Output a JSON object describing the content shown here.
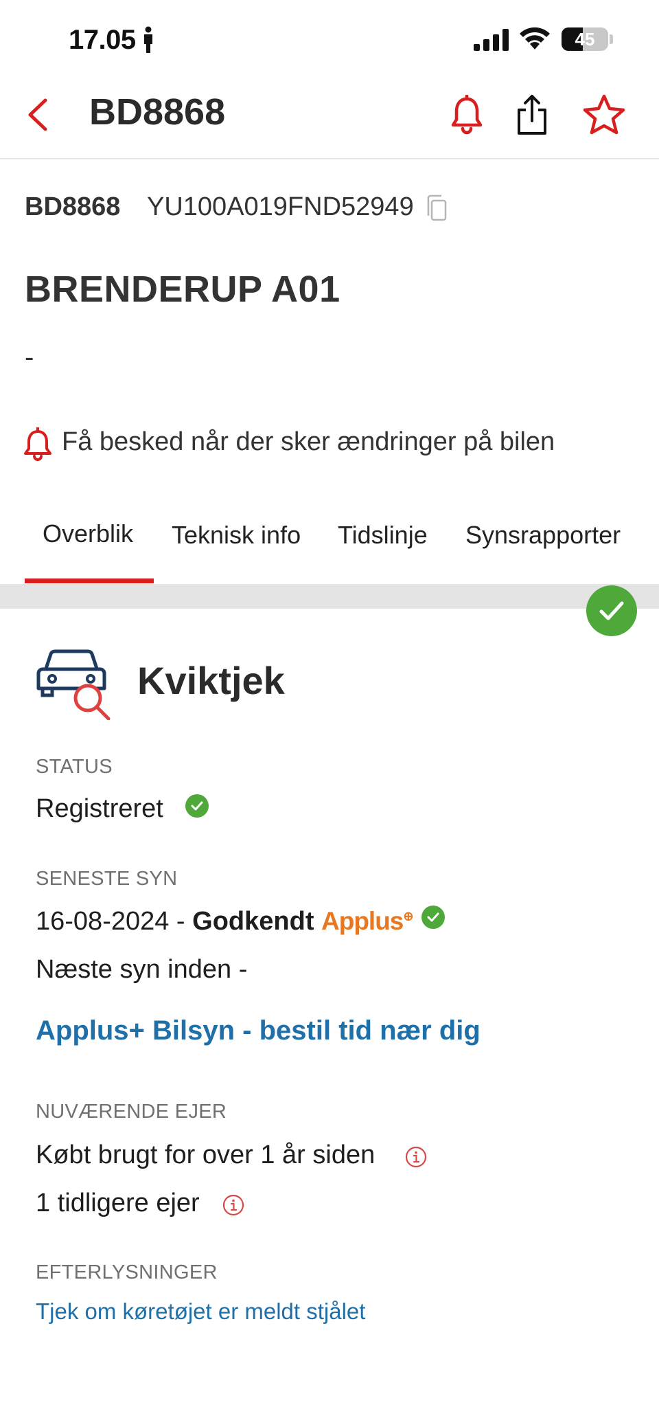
{
  "status_bar": {
    "time": "17.05",
    "battery": "45"
  },
  "nav": {
    "title": "BD8868"
  },
  "vehicle": {
    "plate": "BD8868",
    "vin": "YU100A019FND52949",
    "model": "BRENDERUP A01",
    "variant": "-"
  },
  "notify": {
    "label": "Få besked når der sker ændringer på bilen"
  },
  "tabs": [
    "Overblik",
    "Teknisk info",
    "Tidslinje",
    "Synsrapporter"
  ],
  "card": {
    "title": "Kviktjek",
    "status_label": "STATUS",
    "status_value": "Registreret",
    "inspection_label": "SENESTE SYN",
    "inspection_date": "16-08-2024 - ",
    "inspection_result": "Godkendt",
    "inspection_brand": "Applus",
    "next_inspection": "Næste syn inden -",
    "inspection_link": "Applus+ Bilsyn - bestil tid nær dig",
    "owner_label": "NUVÆRENDE EJER",
    "owner_bought": "Købt brugt for over 1 år siden",
    "owner_previous": "1 tidligere ejer",
    "wanted_label": "EFTERLYSNINGER",
    "wanted_link": "Tjek om køretøjet er meldt stjålet"
  },
  "colors": {
    "accent": "#d81e1e",
    "link": "#1f6fa8",
    "ok": "#4ea83a",
    "brand": "#e87722"
  }
}
